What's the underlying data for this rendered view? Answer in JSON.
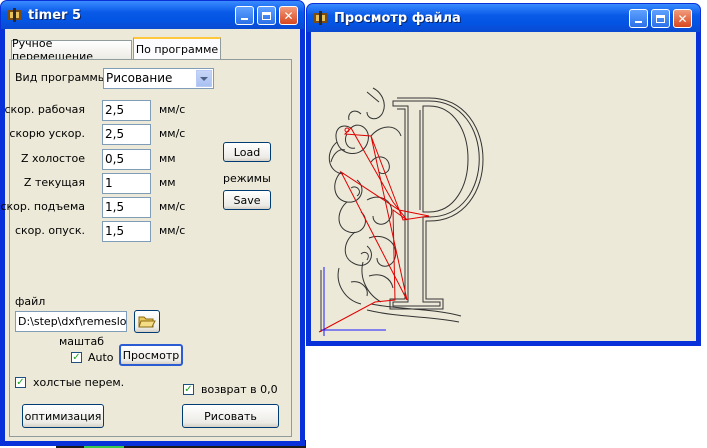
{
  "window_timer": {
    "title": "timer 5",
    "tabs": [
      {
        "label": "Ручное перемещение",
        "active": false
      },
      {
        "label": "По программе",
        "active": true
      }
    ],
    "program_type_label": "Вид программы",
    "program_type_value": "Рисование",
    "params": [
      {
        "label": "скор. рабочая",
        "value": "2,5",
        "unit": "мм/с"
      },
      {
        "label": "скорю ускор.",
        "value": "2,5",
        "unit": "мм/с"
      },
      {
        "label": "Z холостое",
        "value": "0,5",
        "unit": "мм"
      },
      {
        "label": "Z текущая",
        "value": "1",
        "unit": "мм"
      },
      {
        "label": "скор. подъема",
        "value": "1,5",
        "unit": "мм/с"
      },
      {
        "label": "скор. опуск.",
        "value": "1,5",
        "unit": "мм/с"
      }
    ],
    "load_label": "Load",
    "modes_label": "режимы",
    "save_label": "Save",
    "file_label": "файл",
    "file_value": "D:\\step\\dxf\\remeslo.d",
    "scale_label": "маштаб",
    "auto_label": "Auto",
    "auto_checked": true,
    "preview_label": "Просмотр",
    "idle_moves_label": "холстые перем.",
    "idle_moves_checked": true,
    "return_label": "возврат в 0,0",
    "return_checked": true,
    "optimize_label": "оптимизация",
    "draw_label": "Рисовать"
  },
  "window_preview": {
    "title": "Просмотр файла"
  },
  "colors": {
    "title_blue": "#0a5ae8",
    "client_bg": "#ece9d8",
    "close_red": "#d8481f",
    "drawing_line": "#333333",
    "path_red": "#e00000",
    "axis_blue": "#1a1aff"
  }
}
